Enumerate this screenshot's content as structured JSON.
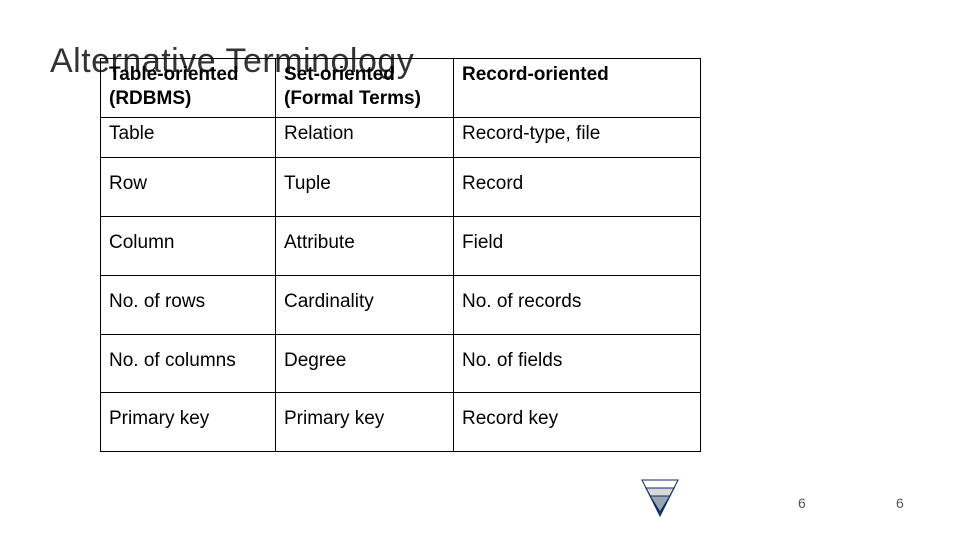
{
  "title": "Alternative Terminology",
  "headers": {
    "col1": "Table-oriented (RDBMS)",
    "col2": "Set-oriented (Formal Terms)",
    "col3": "Record-oriented"
  },
  "rows": [
    {
      "c1": "Table",
      "c2": "Relation",
      "c3": "Record-type, file"
    },
    {
      "c1": "Row",
      "c2": "Tuple",
      "c3": "Record"
    },
    {
      "c1": "Column",
      "c2": "Attribute",
      "c3": "Field"
    },
    {
      "c1": "No. of rows",
      "c2": "Cardinality",
      "c3": "No. of records"
    },
    {
      "c1": "No. of columns",
      "c2": "Degree",
      "c3": "No. of fields"
    },
    {
      "c1": "Primary key",
      "c2": "Primary key",
      "c3": "Record key"
    }
  ],
  "page_number": "6"
}
